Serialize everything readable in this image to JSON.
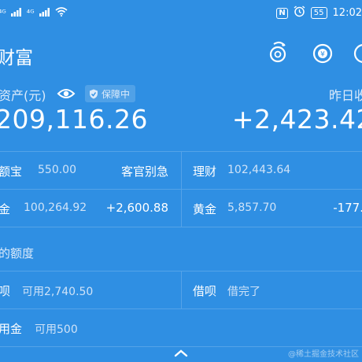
{
  "status": {
    "signal_1": "⁴ᴳ",
    "signal_2": "⁴ᴳ",
    "nfc": "N",
    "battery": "55",
    "time": "12:02"
  },
  "header": {
    "title": "财富"
  },
  "asset": {
    "label": "资产(元)",
    "badge": "保障中",
    "total": "209,116.26",
    "yesterday_label": "昨日收",
    "yesterday_value": "+2,423.42"
  },
  "items": {
    "yuebao": {
      "label": "额宝",
      "value": "550.00",
      "extra": "客官别急"
    },
    "licai": {
      "label": "理财",
      "value": "102,443.64"
    },
    "fund": {
      "label": "金",
      "value": "100,264.92",
      "extra": "+2,600.88"
    },
    "gold": {
      "label": "黄金",
      "value": "5,857.70",
      "extra": "-177."
    }
  },
  "limits": {
    "header": "的额度",
    "huabei": {
      "label": "呗",
      "value": "可用2,740.50"
    },
    "jiebei": {
      "label": "借呗",
      "value": "借完了"
    },
    "credit": {
      "label": "用金",
      "value": "可用500"
    }
  },
  "watermark": "@稀土掘金技术社区",
  "colors": {
    "background": "#2f8fe3",
    "text": "#ffffff",
    "muted": "#cfe3f8"
  }
}
